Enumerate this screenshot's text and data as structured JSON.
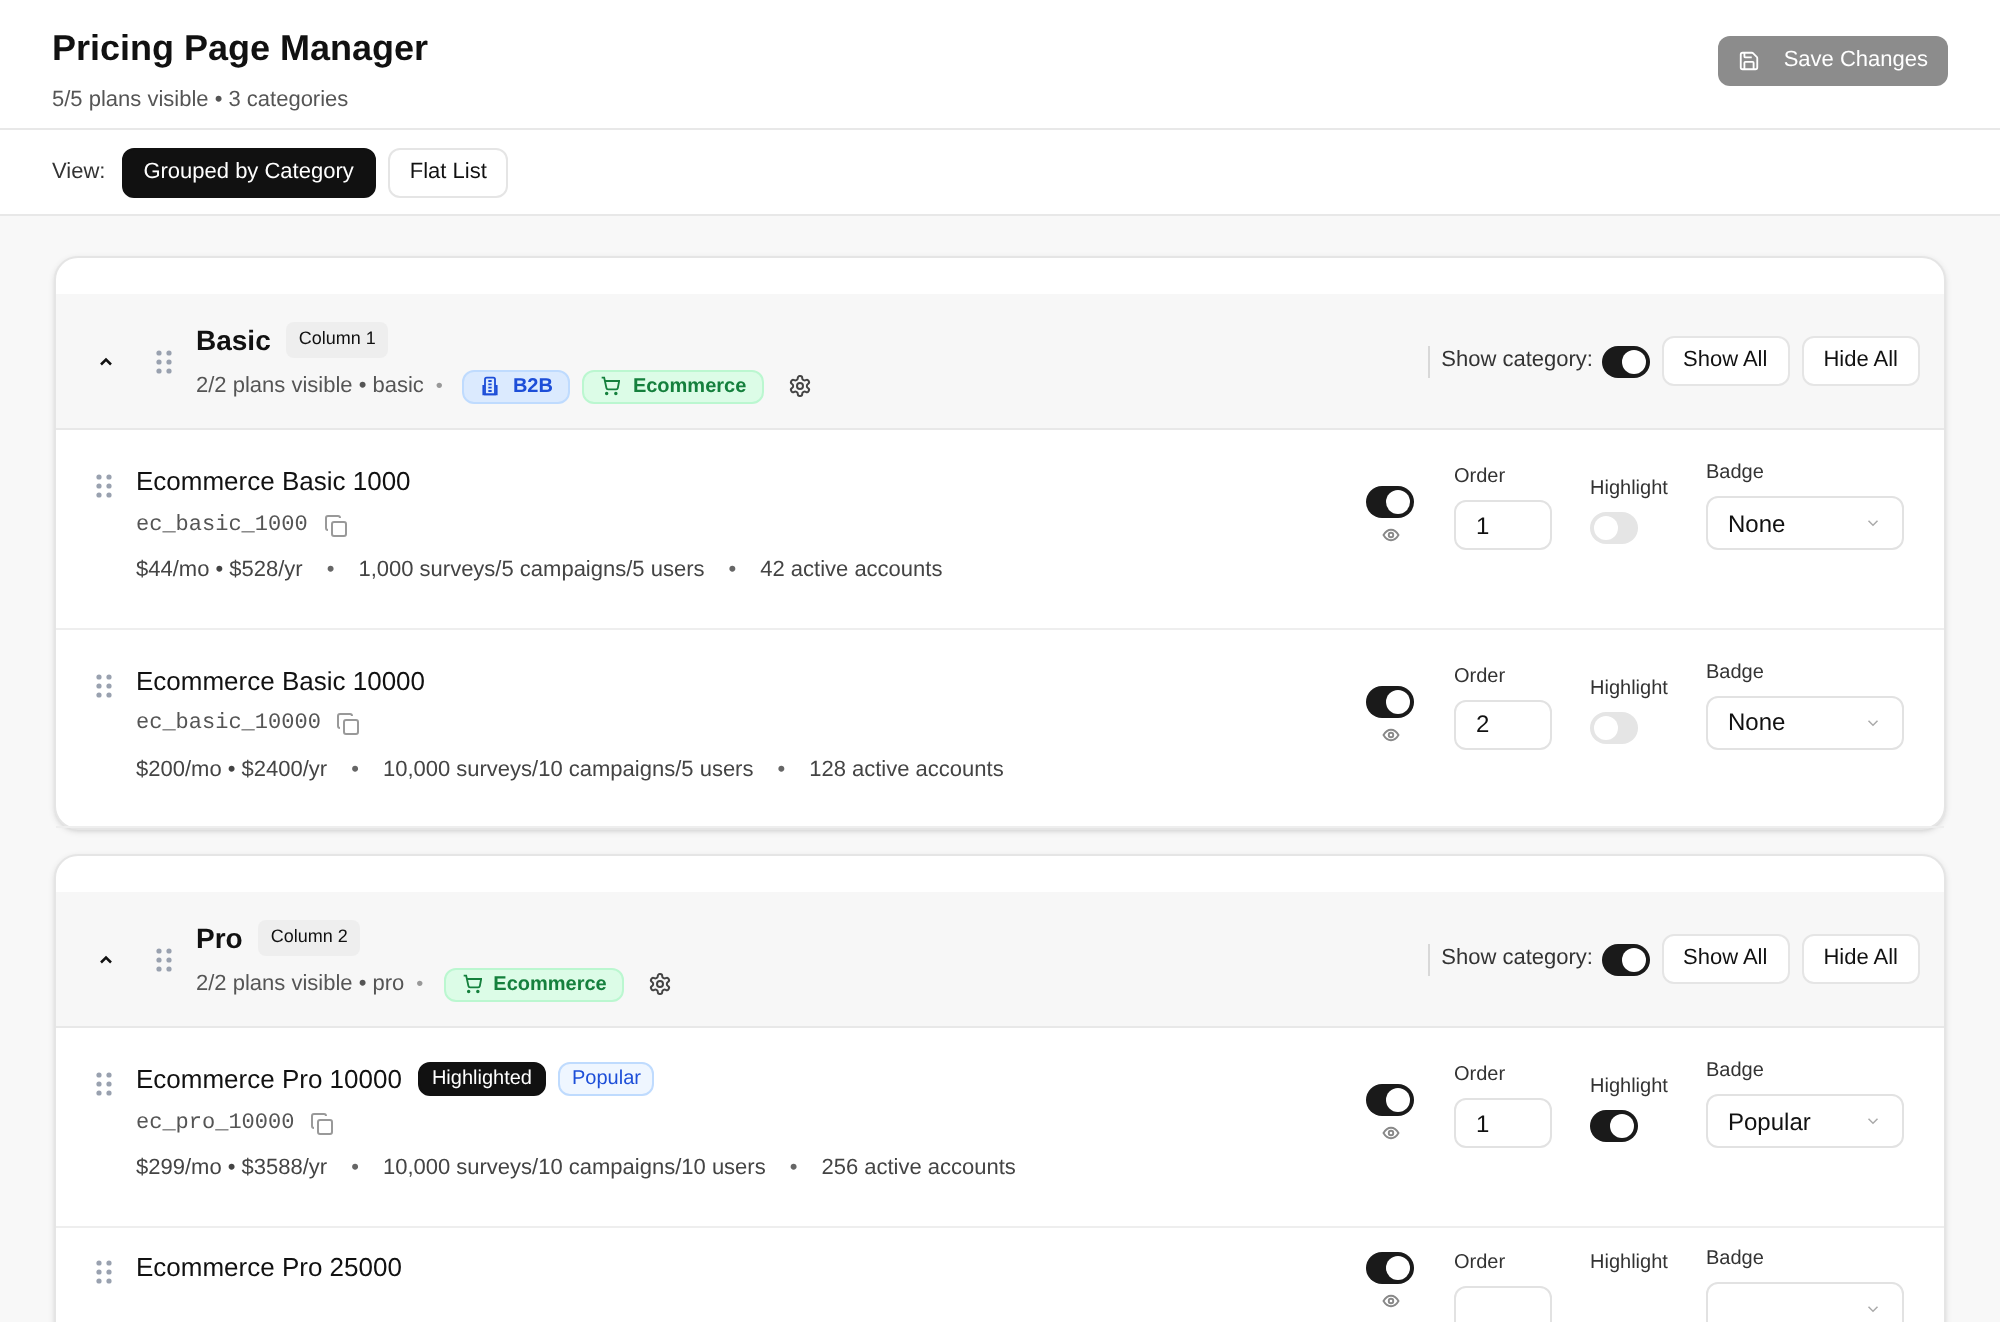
{
  "header": {
    "title": "Pricing Page Manager",
    "subtitle": "5/5 plans visible • 3 categories",
    "save_button": {
      "label": "Save Changes",
      "disabled": true
    }
  },
  "view": {
    "label": "View:",
    "options": [
      {
        "label": "Grouped by Category",
        "selected": true
      },
      {
        "label": "Flat List",
        "selected": false
      }
    ]
  },
  "categories": [
    {
      "name": "Basic",
      "column": "Column 1",
      "expanded": true,
      "summary": "2/2 plans visible • basic",
      "separator": "•",
      "tags": [
        {
          "kind": "b2b",
          "label": "B2B"
        },
        {
          "kind": "ecommerce",
          "label": "Ecommerce"
        }
      ],
      "show_label": "Show category:",
      "shown": true,
      "show_all": "Show All",
      "hide_all": "Hide All",
      "plans": [
        {
          "name": "Ecommerce Basic 1000",
          "slug": "ec_basic_1000",
          "price": "$44/mo • $528/yr",
          "limits": "1,000 surveys/5 campaigns/5 users",
          "separators": [
            "•",
            "•"
          ],
          "accounts": "42 active accounts",
          "visible": true,
          "order_label": "Order",
          "order": "1",
          "highlight_label": "Highlight",
          "highlighted": false,
          "badge_label": "Badge",
          "badge": "None"
        },
        {
          "name": "Ecommerce Basic 10000",
          "slug": "ec_basic_10000",
          "price": "$200/mo • $2400/yr",
          "limits": "10,000 surveys/10 campaigns/5 users",
          "separators": [
            "•",
            "•"
          ],
          "accounts": "128 active accounts",
          "visible": true,
          "order_label": "Order",
          "order": "2",
          "highlight_label": "Highlight",
          "highlighted": false,
          "badge_label": "Badge",
          "badge": "None"
        }
      ]
    },
    {
      "name": "Pro",
      "column": "Column 2",
      "expanded": true,
      "summary": "2/2 plans visible • pro",
      "separator": "•",
      "tags": [
        {
          "kind": "ecommerce",
          "label": "Ecommerce"
        }
      ],
      "show_label": "Show category:",
      "shown": true,
      "show_all": "Show All",
      "hide_all": "Hide All",
      "plans": [
        {
          "name": "Ecommerce Pro 10000",
          "chips": [
            {
              "kind": "highlight",
              "label": "Highlighted"
            },
            {
              "kind": "badge",
              "label": "Popular"
            }
          ],
          "slug": "ec_pro_10000",
          "price": "$299/mo • $3588/yr",
          "limits": "10,000 surveys/10 campaigns/10 users",
          "separators": [
            "•",
            "•"
          ],
          "accounts": "256 active accounts",
          "visible": true,
          "order_label": "Order",
          "order": "1",
          "highlight_label": "Highlight",
          "highlighted": true,
          "badge_label": "Badge",
          "badge": "Popular"
        },
        {
          "name": "Ecommerce Pro 25000",
          "visible": true,
          "order_label": "Order",
          "highlight_label": "Highlight",
          "badge_label": "Badge"
        }
      ]
    }
  ]
}
